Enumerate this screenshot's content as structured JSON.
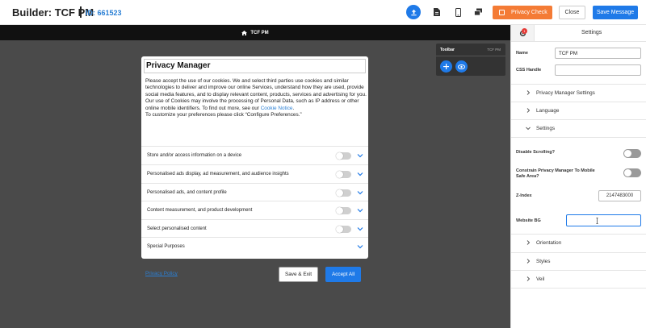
{
  "header": {
    "title": "Builder: TCF PM",
    "id_label": "ID: 661523",
    "privacy_check_label": "Privacy Check",
    "close_label": "Close",
    "save_message_label": "Save Message"
  },
  "canvas": {
    "page_label": "TCF PM",
    "toolbar": {
      "label": "Toolbar",
      "name": "TCF PM"
    }
  },
  "modal": {
    "title": "Privacy Manager",
    "body_text": "Please accept the use of our cookies. We and select third parties use cookies and similar technologies to deliver and improve our online Services, understand how they are used, provide social media features, and to display relevant content, products, services and advertising for you. Our use of Cookies may involve the processing of Personal Data, such as IP address or other online mobile identifiers. To find out more, see our ",
    "cookie_notice_link": "Cookie Notice",
    "body_text_2": ".\nTo customize your preferences please click “Configure Preferences.”",
    "purposes": [
      {
        "label": "Store and/or access information on a device",
        "has_toggle": true
      },
      {
        "label": "Personalised ads display, ad measurement, and audience insights",
        "has_toggle": true
      },
      {
        "label": "Personalised ads, and content profile",
        "has_toggle": true
      },
      {
        "label": "Content measurement, and product development",
        "has_toggle": true
      },
      {
        "label": "Select personalised content",
        "has_toggle": true
      },
      {
        "label": "Special Purposes",
        "has_toggle": false
      }
    ],
    "privacy_policy_label": "Privacy Policy",
    "save_exit_label": "Save & Exit",
    "accept_all_label": "Accept All"
  },
  "panel": {
    "title": "Settings",
    "badge_count": "1",
    "name_label": "Name",
    "name_value": "TCF PM",
    "css_handle_label": "CSS Handle",
    "css_handle_value": "",
    "sections": {
      "privacy_manager_settings": "Privacy Manager Settings",
      "language": "Language",
      "settings": "Settings",
      "orientation": "Orientation",
      "styles": "Styles",
      "veil": "Veil"
    },
    "disable_scrolling_label": "Disable Scrolling?",
    "constrain_label": "Constrain Privacy Manager To Mobile Safe Area?",
    "z_index_label": "Z-Index",
    "z_index_value": "2147483000",
    "website_bg_label": "Website BG",
    "website_bg_value": ""
  },
  "colors": {
    "accent": "#1f7ae8",
    "privacy_check": "#f47b35",
    "canvas_bg": "#4a4a4a"
  }
}
